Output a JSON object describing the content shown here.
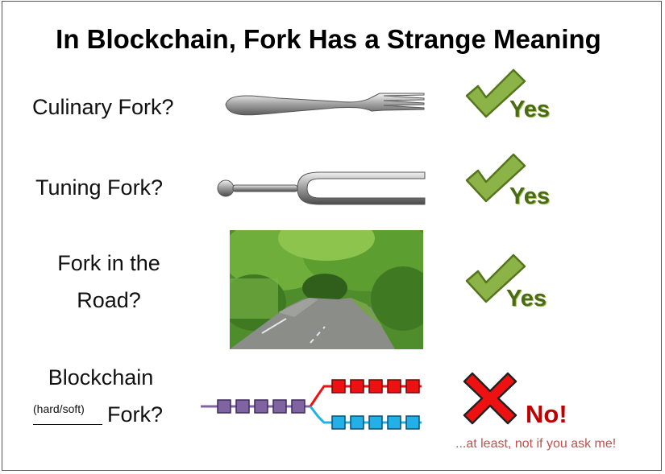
{
  "title": "In Blockchain, Fork Has a Strange Meaning",
  "rows": [
    {
      "question": "Culinary Fork?",
      "answer": "Yes"
    },
    {
      "question": "Tuning Fork?",
      "answer": "Yes"
    },
    {
      "question_line1": "Fork in the",
      "question_line2": "Road?",
      "answer": "Yes"
    },
    {
      "question_line1": "Blockchain",
      "qualifier": "(hard/soft)",
      "question_line2": "Fork?",
      "answer": "No!"
    }
  ],
  "footnote": "...at least, not if you ask me!",
  "colors": {
    "check_green": "#8cb347",
    "cross_red": "#ee1111",
    "chain_purple": "#8064a2",
    "chain_red": "#ee1111",
    "chain_blue": "#22b0e8"
  }
}
